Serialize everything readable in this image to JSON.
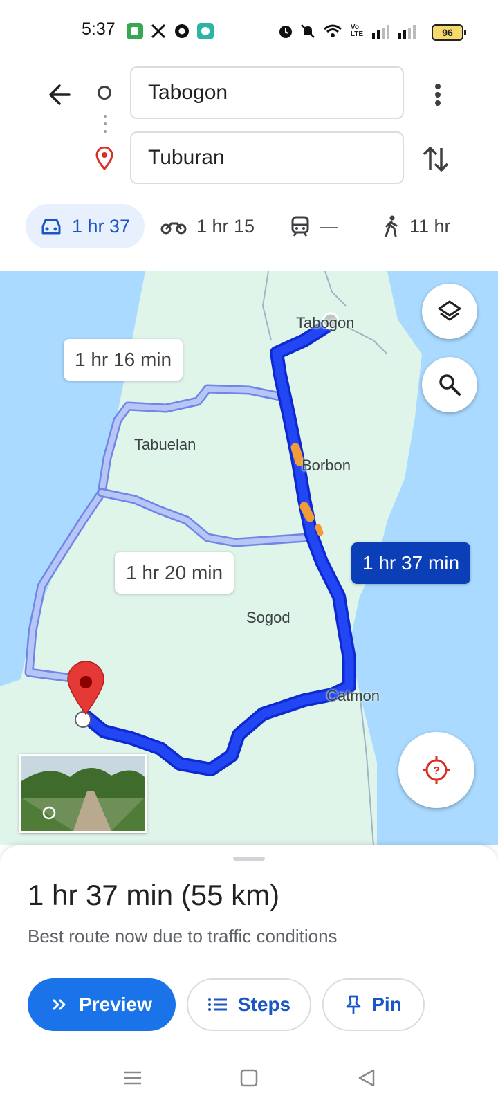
{
  "status_bar": {
    "time": "5:37",
    "icons": [
      "app-icon",
      "x-icon",
      "chrome-icon",
      "chat-icon",
      "alarm-icon",
      "mute-icon",
      "wifi-icon",
      "volte-icon",
      "signal-icon",
      "signal-icon"
    ],
    "volte_label": "Vo\nLTE",
    "battery": "96"
  },
  "route": {
    "origin": "Tabogon",
    "destination": "Tuburan"
  },
  "modes": [
    {
      "name": "drive",
      "label": "1 hr 37",
      "selected": true
    },
    {
      "name": "motorcycle",
      "label": "1 hr 15"
    },
    {
      "name": "transit",
      "label": "—"
    },
    {
      "name": "walk",
      "label": "11 hr"
    }
  ],
  "map": {
    "route_labels": {
      "alt1": "1 hr 16 min",
      "alt2": "1 hr 20 min",
      "best": "1 hr 37 min"
    },
    "places": {
      "tabogon": "Tabogon",
      "tabuelan": "Tabuelan",
      "borbon": "Borbon",
      "sogod": "Sogod",
      "catmon": "Catmon"
    },
    "colors": {
      "water": "#aadaff",
      "land": "#dff5ea",
      "route": "#1a3bf0",
      "alt_route": "#a8b9f5",
      "traffic": "#f29c38"
    }
  },
  "sheet": {
    "summary": "1 hr 37 min (55 km)",
    "reason": "Best route now due to traffic conditions",
    "buttons": {
      "preview": "Preview",
      "steps": "Steps",
      "pin": "Pin"
    }
  }
}
